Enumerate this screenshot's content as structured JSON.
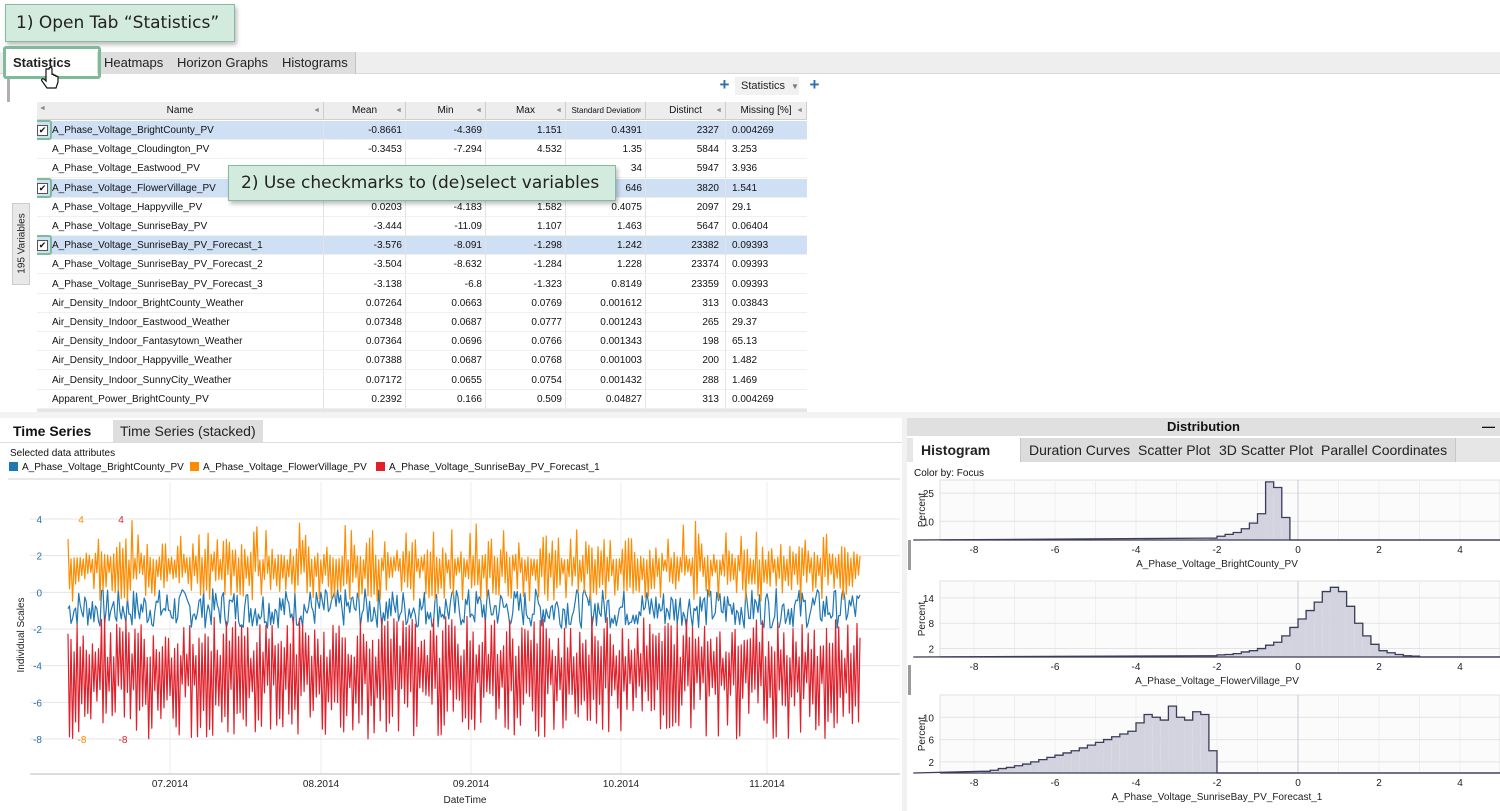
{
  "callouts": {
    "step1": "1) Open Tab “Statistics”",
    "step2": "2) Use checkmarks to (de)select variables"
  },
  "top_tabs": [
    "Statistics",
    "Heatmaps",
    "Horizon Graphs",
    "Histograms"
  ],
  "toolbar": {
    "dropdown": "Statistics",
    "add_icon": "plus-icon"
  },
  "sidebar": {
    "variables_label": "195 Variables"
  },
  "stats_table": {
    "columns": [
      "Name",
      "Mean",
      "Min",
      "Max",
      "Standard Deviation",
      "Distinct",
      "Missing [%]"
    ],
    "rows": [
      {
        "checked": true,
        "name": "A_Phase_Voltage_BrightCounty_PV",
        "mean": "-0.8661",
        "min": "-4.369",
        "max": "1.151",
        "std": "0.4391",
        "distinct": "2327",
        "missing": "0.004269"
      },
      {
        "checked": false,
        "name": "A_Phase_Voltage_Cloudington_PV",
        "mean": "-0.3453",
        "min": "-7.294",
        "max": "4.532",
        "std": "1.35",
        "distinct": "5844",
        "missing": "3.253"
      },
      {
        "checked": false,
        "name": "A_Phase_Voltage_Eastwood_PV",
        "mean": "",
        "min": "",
        "max": "",
        "std": "34",
        "distinct": "5947",
        "missing": "3.936"
      },
      {
        "checked": true,
        "name": "A_Phase_Voltage_FlowerVillage_PV",
        "mean": "",
        "min": "",
        "max": "",
        "std": "646",
        "distinct": "3820",
        "missing": "1.541"
      },
      {
        "checked": false,
        "name": "A_Phase_Voltage_Happyville_PV",
        "mean": "0.0203",
        "min": "-4.183",
        "max": "1.582",
        "std": "0.4075",
        "distinct": "2097",
        "missing": "29.1"
      },
      {
        "checked": false,
        "name": "A_Phase_Voltage_SunriseBay_PV",
        "mean": "-3.444",
        "min": "-11.09",
        "max": "1.107",
        "std": "1.463",
        "distinct": "5647",
        "missing": "0.06404"
      },
      {
        "checked": true,
        "name": "A_Phase_Voltage_SunriseBay_PV_Forecast_1",
        "mean": "-3.576",
        "min": "-8.091",
        "max": "-1.298",
        "std": "1.242",
        "distinct": "23382",
        "missing": "0.09393"
      },
      {
        "checked": false,
        "name": "A_Phase_Voltage_SunriseBay_PV_Forecast_2",
        "mean": "-3.504",
        "min": "-8.632",
        "max": "-1.284",
        "std": "1.228",
        "distinct": "23374",
        "missing": "0.09393"
      },
      {
        "checked": false,
        "name": "A_Phase_Voltage_SunriseBay_PV_Forecast_3",
        "mean": "-3.138",
        "min": "-6.8",
        "max": "-1.323",
        "std": "0.8149",
        "distinct": "23359",
        "missing": "0.09393"
      },
      {
        "checked": false,
        "name": "Air_Density_Indoor_BrightCounty_Weather",
        "mean": "0.07264",
        "min": "0.0663",
        "max": "0.0769",
        "std": "0.001612",
        "distinct": "313",
        "missing": "0.03843"
      },
      {
        "checked": false,
        "name": "Air_Density_Indoor_Eastwood_Weather",
        "mean": "0.07348",
        "min": "0.0687",
        "max": "0.0777",
        "std": "0.001243",
        "distinct": "265",
        "missing": "29.37"
      },
      {
        "checked": false,
        "name": "Air_Density_Indoor_Fantasytown_Weather",
        "mean": "0.07364",
        "min": "0.0696",
        "max": "0.0766",
        "std": "0.001343",
        "distinct": "198",
        "missing": "65.13"
      },
      {
        "checked": false,
        "name": "Air_Density_Indoor_Happyville_Weather",
        "mean": "0.07388",
        "min": "0.0687",
        "max": "0.0768",
        "std": "0.001003",
        "distinct": "200",
        "missing": "1.482"
      },
      {
        "checked": false,
        "name": "Air_Density_Indoor_SunnyCity_Weather",
        "mean": "0.07172",
        "min": "0.0655",
        "max": "0.0754",
        "std": "0.001432",
        "distinct": "288",
        "missing": "1.469"
      },
      {
        "checked": false,
        "name": "Apparent_Power_BrightCounty_PV",
        "mean": "0.2392",
        "min": "0.166",
        "max": "0.509",
        "std": "0.04827",
        "distinct": "313",
        "missing": "0.004269"
      }
    ]
  },
  "bottom_tabs": [
    "Time Series",
    "Time Series (stacked)"
  ],
  "timeseries": {
    "selected_label": "Selected data attributes",
    "series": [
      {
        "name": "A_Phase_Voltage_BrightCounty_PV",
        "color": "#1f77b4"
      },
      {
        "name": "A_Phase_Voltage_FlowerVillage_PV",
        "color": "#ff8c00"
      },
      {
        "name": "A_Phase_Voltage_SunriseBay_PV_Forecast_1",
        "color": "#e0212b"
      }
    ],
    "ylabel": "Individual Scales",
    "xlabel": "DateTime",
    "y_ticks": [
      4,
      2,
      0,
      -2,
      -4,
      -6,
      -8
    ],
    "x_ticks": [
      "07.2014",
      "08.2014",
      "09.2014",
      "10.2014",
      "11.2014"
    ]
  },
  "distribution": {
    "title": "Distribution",
    "minimize": "—",
    "tabs": [
      "Histogram",
      "Duration Curves",
      "Scatter Plot",
      "3D Scatter Plot",
      "Parallel Coordinates"
    ],
    "color_by": "Color by: Focus",
    "ylabel": "Percent",
    "x_ticks": [
      "-8",
      "-6",
      "-4",
      "-2",
      "0",
      "2",
      "4"
    ]
  },
  "chart_data": [
    {
      "type": "line",
      "title": "",
      "xlabel": "DateTime",
      "ylabel": "Individual Scales",
      "x_range": [
        "2014-06",
        "2014-11"
      ],
      "ylim": [
        -9,
        5
      ],
      "series": [
        {
          "name": "A_Phase_Voltage_BrightCounty_PV",
          "color": "#1f77b4",
          "center": -0.87,
          "range": [
            -2.1,
            0.3
          ]
        },
        {
          "name": "A_Phase_Voltage_FlowerVillage_PV",
          "color": "#ff8c00",
          "center": 1.2,
          "range": [
            -0.5,
            4
          ]
        },
        {
          "name": "A_Phase_Voltage_SunriseBay_PV_Forecast_1",
          "color": "#e0212b",
          "center": -3.6,
          "range": [
            -8,
            -1.3
          ]
        }
      ]
    },
    {
      "type": "bar",
      "xlabel": "A_Phase_Voltage_BrightCounty_PV",
      "ylabel": "Percent",
      "y_ticks": [
        10,
        25
      ],
      "ylim": [
        0,
        32
      ],
      "bin_width": 0.2,
      "bins_start": [
        -2.2,
        -2.0,
        -1.8,
        -1.6,
        -1.4,
        -1.2,
        -1.0,
        -0.8,
        -0.6,
        -0.4,
        -0.2
      ],
      "values": [
        1,
        2,
        3,
        4,
        6,
        9,
        14,
        31,
        28,
        12,
        0
      ]
    },
    {
      "type": "bar",
      "xlabel": "A_Phase_Voltage_FlowerVillage_PV",
      "ylabel": "Percent",
      "y_ticks": [
        2,
        8,
        14
      ],
      "ylim": [
        0,
        18
      ],
      "bin_width": 0.2,
      "bins_start": [
        -2.2,
        -2.0,
        -1.8,
        -1.6,
        -1.4,
        -1.2,
        -1.0,
        -0.8,
        -0.6,
        -0.4,
        -0.2,
        0.0,
        0.2,
        0.4,
        0.6,
        0.8,
        1.0,
        1.2,
        1.4,
        1.6,
        1.8,
        2.0,
        2.2,
        2.4,
        2.6,
        2.8
      ],
      "values": [
        0.3,
        0.5,
        0.6,
        0.8,
        1.2,
        1.5,
        2,
        2.8,
        3.5,
        5,
        7,
        9,
        11,
        13,
        15.5,
        16.5,
        15.5,
        12,
        8,
        5,
        3,
        1.5,
        1,
        0.6,
        0.3,
        0.2
      ]
    },
    {
      "type": "bar",
      "xlabel": "A_Phase_Voltage_SunriseBay_PV_Forecast_1",
      "ylabel": "Percent",
      "y_ticks": [
        2,
        6,
        10
      ],
      "ylim": [
        0,
        14
      ],
      "bin_width": 0.2,
      "bins_start": [
        -7.8,
        -7.6,
        -7.4,
        -7.2,
        -7.0,
        -6.8,
        -6.6,
        -6.4,
        -6.2,
        -6.0,
        -5.8,
        -5.6,
        -5.4,
        -5.2,
        -5.0,
        -4.8,
        -4.6,
        -4.4,
        -4.2,
        -4.0,
        -3.8,
        -3.6,
        -3.4,
        -3.2,
        -3.0,
        -2.8,
        -2.6,
        -2.4,
        -2.2,
        -2.0,
        -1.8
      ],
      "values": [
        0.3,
        0.5,
        0.8,
        1,
        1.3,
        1.6,
        2,
        2.4,
        2.8,
        3.2,
        3.6,
        4,
        4.5,
        5,
        5.5,
        6,
        6.5,
        7,
        7.5,
        9,
        10.5,
        10,
        9.5,
        12,
        10,
        9.5,
        11,
        10.5,
        4,
        0,
        0
      ]
    }
  ]
}
